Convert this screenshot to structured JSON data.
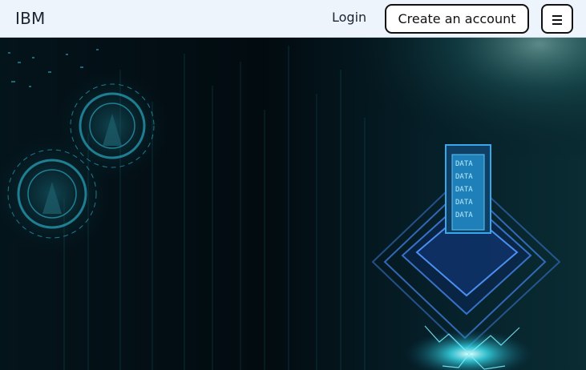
{
  "navbar": {
    "brand": "IBM",
    "login_label": "Login",
    "create_account_label": "Create an account",
    "menu_icon": "hamburger-menu-icon"
  },
  "hero": {
    "image": "futuristic-tech-circuit-background",
    "chip_text": [
      "DATA",
      "DATA",
      "DATA",
      "DATA",
      "DATA"
    ]
  }
}
